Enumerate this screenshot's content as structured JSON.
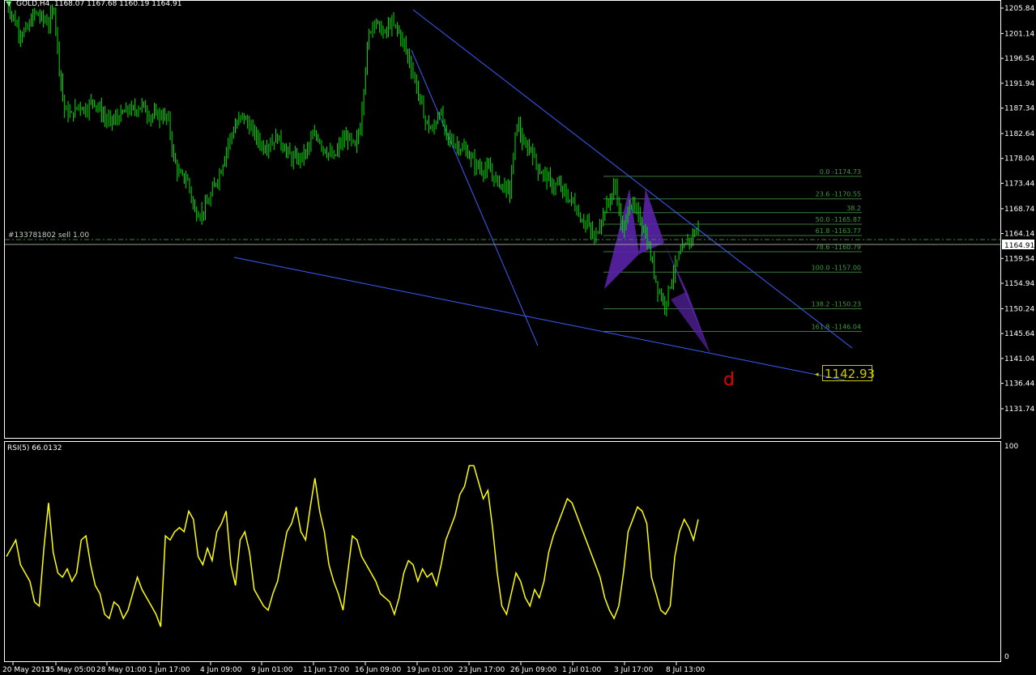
{
  "header": {
    "symbol": "GOLD,H4",
    "ohlc": "1168.07 1167.68 1160.19 1164.91"
  },
  "order_label": "#133781802 sell 1.00",
  "current_price": "1164.91",
  "target_price": "1142.93",
  "pattern_point": "d",
  "rsi_label": "RSI(5) 66.0132",
  "rsi_axis": [
    "100",
    "0"
  ],
  "price_axis": [
    "1205.84",
    "1201.14",
    "1196.54",
    "1191.94",
    "1187.34",
    "1182.64",
    "1178.04",
    "1173.44",
    "1168.74",
    "1164.14",
    "1159.54",
    "1154.94",
    "1150.24",
    "1145.64",
    "1141.04",
    "1136.44",
    "1131.74"
  ],
  "time_axis": [
    "20 May 2015",
    "25 May 05:00",
    "28 May 01:00",
    "1 Jun 17:00",
    "4 Jun 09:00",
    "9 Jun 01:00",
    "11 Jun 17:00",
    "16 Jun 09:00",
    "19 Jun 01:00",
    "23 Jun 17:00",
    "26 Jun 09:00",
    "1 Jul 01:00",
    "3 Jul 17:00",
    "8 Jul 13:00"
  ],
  "fib_levels": [
    {
      "label": "0.0 -1174.73",
      "price": 1174.73
    },
    {
      "label": "23.6 -1170.55",
      "price": 1170.55
    },
    {
      "label": "38.2",
      "price": 1168.0
    },
    {
      "label": "50.0 -1165.87",
      "price": 1165.87
    },
    {
      "label": "61.8 -1163.77",
      "price": 1163.77
    },
    {
      "label": "78.6 -1160.79",
      "price": 1160.79
    },
    {
      "label": "100.0 -1157.00",
      "price": 1157.0
    },
    {
      "label": "138.2 -1150.23",
      "price": 1150.23
    },
    {
      "label": "161.8 -1146.04",
      "price": 1146.04
    }
  ],
  "colors": {
    "candle": "#00e000",
    "axis": "#ffffff",
    "trendline": "#3a5fff",
    "fib": "#3c7a3c",
    "fibtext": "#3c9a3c",
    "pattern": "#5a24a8",
    "rsi": "#ffff00",
    "order": "#2e8b2e",
    "price_box": "#ffffff",
    "target": "#c8c800",
    "d_label": "#e00000"
  },
  "chart_data": {
    "type": "candlestick",
    "symbol": "GOLD,H4",
    "ylim": [
      1131.74,
      1207.5
    ],
    "close_path": [
      [
        0,
        1207
      ],
      [
        4,
        1204
      ],
      [
        8,
        1201
      ],
      [
        12,
        1202
      ],
      [
        16,
        1205
      ],
      [
        20,
        1204
      ],
      [
        24,
        1203
      ],
      [
        27,
        1206
      ],
      [
        30,
        1195
      ],
      [
        33,
        1187
      ],
      [
        37,
        1186
      ],
      [
        41,
        1188
      ],
      [
        45,
        1187
      ],
      [
        49,
        1189
      ],
      [
        53,
        1187
      ],
      [
        57,
        1185
      ],
      [
        61,
        1185
      ],
      [
        65,
        1186
      ],
      [
        69,
        1187
      ],
      [
        73,
        1187
      ],
      [
        77,
        1188
      ],
      [
        81,
        1186
      ],
      [
        85,
        1186
      ],
      [
        89,
        1186
      ],
      [
        92,
        1185
      ],
      [
        95,
        1178
      ],
      [
        98,
        1175
      ],
      [
        103,
        1174
      ],
      [
        107,
        1168
      ],
      [
        111,
        1168
      ],
      [
        115,
        1170
      ],
      [
        118,
        1173
      ],
      [
        122,
        1176
      ],
      [
        126,
        1181
      ],
      [
        130,
        1184
      ],
      [
        134,
        1186
      ],
      [
        138,
        1184
      ],
      [
        142,
        1182
      ],
      [
        146,
        1180
      ],
      [
        150,
        1181
      ],
      [
        154,
        1182
      ],
      [
        158,
        1180
      ],
      [
        162,
        1178
      ],
      [
        166,
        1178
      ],
      [
        170,
        1179
      ],
      [
        174,
        1182
      ],
      [
        177,
        1182
      ],
      [
        180,
        1180
      ],
      [
        183,
        1179
      ],
      [
        186,
        1178
      ],
      [
        190,
        1181
      ],
      [
        194,
        1182
      ],
      [
        198,
        1180
      ],
      [
        201,
        1184
      ],
      [
        204,
        1195
      ],
      [
        206,
        1201
      ],
      [
        209,
        1204
      ],
      [
        212,
        1202
      ],
      [
        215,
        1201
      ],
      [
        218,
        1203
      ],
      [
        222,
        1202
      ],
      [
        226,
        1199
      ],
      [
        230,
        1195
      ],
      [
        234,
        1190
      ],
      [
        238,
        1185
      ],
      [
        242,
        1183
      ],
      [
        246,
        1187
      ],
      [
        250,
        1182
      ],
      [
        254,
        1181
      ],
      [
        258,
        1180
      ],
      [
        262,
        1179
      ],
      [
        266,
        1177
      ],
      [
        270,
        1176
      ],
      [
        274,
        1176
      ],
      [
        278,
        1174
      ],
      [
        282,
        1173
      ],
      [
        286,
        1172
      ],
      [
        290,
        1185
      ],
      [
        294,
        1180
      ],
      [
        298,
        1180
      ],
      [
        302,
        1176
      ],
      [
        306,
        1175
      ],
      [
        310,
        1173
      ],
      [
        314,
        1173
      ],
      [
        318,
        1171
      ],
      [
        322,
        1170
      ],
      [
        326,
        1167
      ],
      [
        330,
        1166
      ],
      [
        334,
        1163
      ],
      [
        338,
        1167
      ],
      [
        342,
        1170
      ],
      [
        346,
        1173
      ],
      [
        350,
        1164
      ],
      [
        354,
        1170
      ],
      [
        358,
        1168
      ],
      [
        362,
        1165
      ],
      [
        366,
        1160
      ],
      [
        370,
        1154
      ],
      [
        374,
        1151
      ],
      [
        378,
        1156
      ],
      [
        382,
        1160
      ],
      [
        386,
        1162
      ],
      [
        390,
        1164
      ],
      [
        393,
        1165
      ]
    ],
    "trendlines": [
      {
        "from": [
          1184,
          1205.8
        ],
        "to": [
          1225,
          1148.0
        ]
      },
      {
        "from": [
          1184,
          1197.0
        ],
        "to": [
          1205,
          1149.0
        ]
      },
      {
        "from": [
          1151,
          1163.6
        ],
        "to": [
          1278,
          1141.5
        ]
      }
    ],
    "rsi": {
      "name": "RSI(5)",
      "last": 66.0132,
      "ylim": [
        0,
        100
      ],
      "values": [
        48,
        52,
        56,
        44,
        40,
        36,
        26,
        24,
        52,
        74,
        50,
        40,
        38,
        42,
        36,
        40,
        56,
        58,
        44,
        34,
        30,
        20,
        18,
        26,
        24,
        18,
        22,
        30,
        38,
        32,
        28,
        24,
        20,
        14,
        58,
        56,
        60,
        62,
        60,
        70,
        66,
        48,
        44,
        52,
        46,
        60,
        64,
        70,
        44,
        34,
        56,
        60,
        50,
        32,
        28,
        24,
        22,
        30,
        36,
        48,
        60,
        64,
        72,
        60,
        56,
        72,
        86,
        70,
        60,
        44,
        36,
        30,
        22,
        40,
        58,
        56,
        48,
        44,
        40,
        36,
        30,
        28,
        26,
        20,
        28,
        40,
        46,
        44,
        36,
        42,
        38,
        40,
        34,
        44,
        56,
        62,
        68,
        78,
        82,
        92,
        92,
        84,
        76,
        80,
        62,
        40,
        24,
        20,
        30,
        40,
        36,
        28,
        24,
        32,
        28,
        36,
        50,
        58,
        64,
        70,
        76,
        74,
        68,
        62,
        56,
        50,
        44,
        38,
        28,
        22,
        18,
        24,
        40,
        60,
        66,
        72,
        70,
        64,
        38,
        30,
        22,
        20,
        24,
        48,
        60,
        66,
        62,
        56,
        66
      ]
    }
  }
}
